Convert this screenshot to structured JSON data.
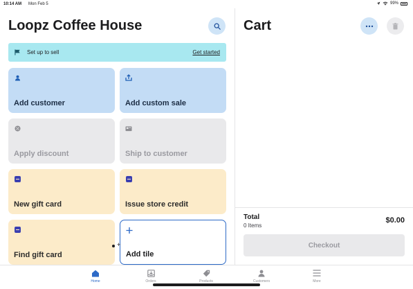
{
  "status_bar": {
    "time": "10:14 AM",
    "date": "Mon Feb 5",
    "battery": "99%"
  },
  "left": {
    "title": "Loopz Coffee House",
    "banner": {
      "label": "Set up to sell",
      "link": "Get started"
    },
    "tiles": [
      {
        "label": "Add customer",
        "icon": "person-icon",
        "color": "blue"
      },
      {
        "label": "Add custom sale",
        "icon": "upload-icon",
        "color": "blue"
      },
      {
        "label": "Apply discount",
        "icon": "discount-icon",
        "color": "gray"
      },
      {
        "label": "Ship to customer",
        "icon": "shipping-icon",
        "color": "gray"
      },
      {
        "label": "New gift card",
        "icon": "gift-card-icon",
        "color": "yellow"
      },
      {
        "label": "Issue store credit",
        "icon": "gift-card-icon",
        "color": "yellow"
      },
      {
        "label": "Find gift card",
        "icon": "gift-card-icon",
        "color": "yellow"
      },
      {
        "label": "Add tile",
        "icon": "plus-icon",
        "color": "outline"
      }
    ]
  },
  "cart": {
    "title": "Cart",
    "total_label": "Total",
    "items_count": "0 Items",
    "total_amount": "$0.00",
    "checkout_label": "Checkout"
  },
  "tabs": [
    {
      "label": "Home",
      "icon": "home-icon",
      "active": true
    },
    {
      "label": "Orders",
      "icon": "orders-icon",
      "active": false
    },
    {
      "label": "Products",
      "icon": "tag-icon",
      "active": false
    },
    {
      "label": "Customers",
      "icon": "person-icon",
      "active": false
    },
    {
      "label": "More",
      "icon": "menu-icon",
      "active": false
    }
  ],
  "colors": {
    "accent": "#2d6ac7",
    "banner": "#a8e8f0",
    "tile_blue": "#c3dcf5",
    "tile_gray": "#e9e9eb",
    "tile_yellow": "#fcebc9"
  }
}
